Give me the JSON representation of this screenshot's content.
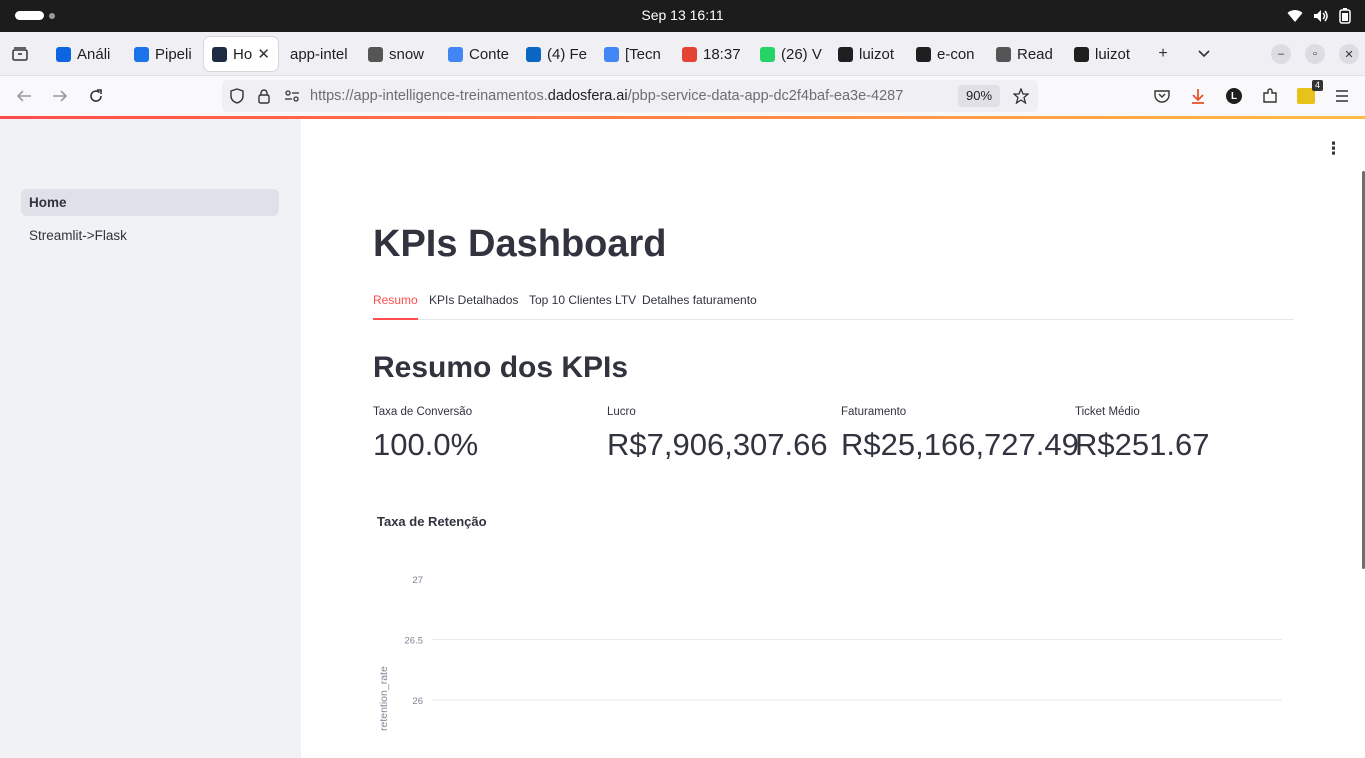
{
  "os": {
    "clock": "Sep 13  16:11",
    "icons": [
      "wifi-icon",
      "volume-icon",
      "battery-icon"
    ]
  },
  "browser": {
    "tabs": [
      {
        "title": "Análi",
        "icon": "trello-icon",
        "color": "#0c66e4"
      },
      {
        "title": "Pipeli",
        "icon": "pipedrive-icon",
        "color": "#1a73e8"
      },
      {
        "title": "Ho",
        "icon": "streamlit-icon",
        "color": "#1f2a44",
        "active": true
      },
      {
        "title": "app-intel",
        "icon": "none",
        "color": "#f0f0f4"
      },
      {
        "title": "snow",
        "icon": "snowflake-icon",
        "color": "#555555"
      },
      {
        "title": "Conte",
        "icon": "docs-icon",
        "color": "#4285f4"
      },
      {
        "title": "(4) Fe",
        "icon": "linkedin-icon",
        "color": "#0a66c2"
      },
      {
        "title": "[Tecn",
        "icon": "docs-icon",
        "color": "#4285f4"
      },
      {
        "title": "18:37",
        "icon": "todoist-icon",
        "color": "#e44232"
      },
      {
        "title": "(26) V",
        "icon": "whatsapp-icon",
        "color": "#25d366"
      },
      {
        "title": "luizot",
        "icon": "github-icon",
        "color": "#1f1f1f"
      },
      {
        "title": "e-con",
        "icon": "trello-icon",
        "color": "#1f1f1f"
      },
      {
        "title": "Read",
        "icon": "openai-icon",
        "color": "#555555"
      },
      {
        "title": "luizot",
        "icon": "github-icon",
        "color": "#1f1f1f"
      }
    ],
    "url": {
      "prefix": "https://app-intelligence-treinamentos.",
      "domain": "dadosfera.ai",
      "path": "/pbp-service-data-app-dc2f4baf-ea3e-4287"
    },
    "zoom": "90%",
    "extension_badge": "4",
    "profile_letter": "L"
  },
  "sidebar": {
    "items": [
      {
        "label": "Home",
        "active": true
      },
      {
        "label": "Streamlit->Flask",
        "active": false
      }
    ]
  },
  "main": {
    "title": "KPIs Dashboard",
    "tabs": [
      "Resumo",
      "KPIs Detalhados",
      "Top 10 Clientes LTV",
      "Detalhes faturamento"
    ],
    "active_tab": "Resumo",
    "section_title": "Resumo dos KPIs",
    "metrics": [
      {
        "label": "Taxa de Conversão",
        "value": "100.0%"
      },
      {
        "label": "Lucro",
        "value": "R$7,906,307.66"
      },
      {
        "label": "Faturamento",
        "value": "R$25,166,727.49"
      },
      {
        "label": "Ticket Médio",
        "value": "R$251.67"
      }
    ]
  },
  "chart_data": {
    "type": "line",
    "title": "Taxa de Retenção",
    "xlabel": "",
    "ylabel": "retention_rate",
    "y_ticks": [
      "27",
      "26.5",
      "26"
    ],
    "ylim": [
      25.5,
      27
    ],
    "grid": true,
    "series": []
  },
  "colors": {
    "accent": "#ff4b4b",
    "text": "#31333f",
    "sidebar_bg": "#f0f2f6"
  }
}
